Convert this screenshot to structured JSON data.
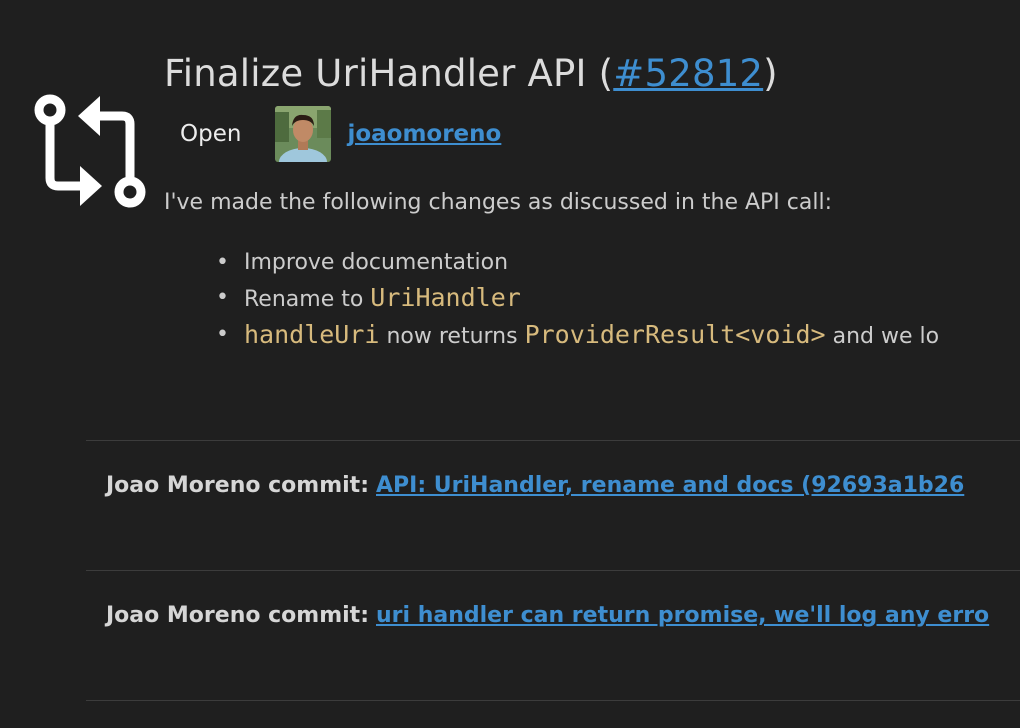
{
  "pr": {
    "title_prefix": "Finalize UriHandler API (",
    "number": "#52812",
    "title_suffix": ")",
    "status": "Open",
    "author": "joaomoreno",
    "description": "I've made the following changes as discussed in the API call:",
    "changes": [
      {
        "text": "Improve documentation"
      },
      {
        "prefix": "Rename to ",
        "code": "UriHandler"
      },
      {
        "code1": "handleUri",
        "mid": " now returns ",
        "code2": "ProviderResult<void>",
        "suffix": " and we lo"
      }
    ],
    "icon": "git-pull-request-icon"
  },
  "commits": [
    {
      "author": "Joao Moreno commit:",
      "message": "API: UriHandler, rename and docs (92693a1b26"
    },
    {
      "author": "Joao Moreno commit:",
      "message": "uri handler can return promise, we'll log any erro"
    }
  ],
  "colors": {
    "background": "#1f1f1f",
    "link": "#3e8ed0",
    "code": "#d7ba7d",
    "text": "#cccccc"
  }
}
